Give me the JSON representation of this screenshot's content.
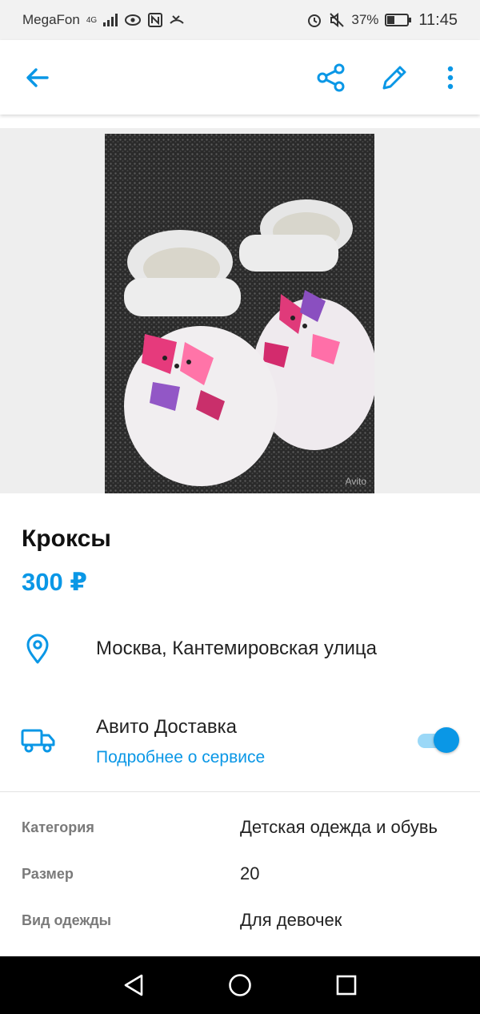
{
  "status_bar": {
    "carrier": "MegaFon",
    "network": "4G",
    "battery_percent": "37%",
    "time": "11:45"
  },
  "app_bar": {
    "icons": [
      "back-arrow-icon",
      "share-icon",
      "edit-icon",
      "more-vert-icon"
    ]
  },
  "photo": {
    "watermark": "Avito"
  },
  "listing": {
    "title": "Кроксы",
    "price": "300 ₽",
    "location": "Москва, Кантемировская улица",
    "delivery": {
      "name": "Авито Доставка",
      "link": "Подробнее о сервисе",
      "enabled": true
    }
  },
  "params": [
    {
      "key": "Категория",
      "value": "Детская одежда и обувь"
    },
    {
      "key": "Размер",
      "value": "20"
    },
    {
      "key": "Вид одежды",
      "value": "Для девочек"
    }
  ],
  "colors": {
    "accent": "#0a97e6",
    "toggle_track": "#9bd8f7"
  }
}
